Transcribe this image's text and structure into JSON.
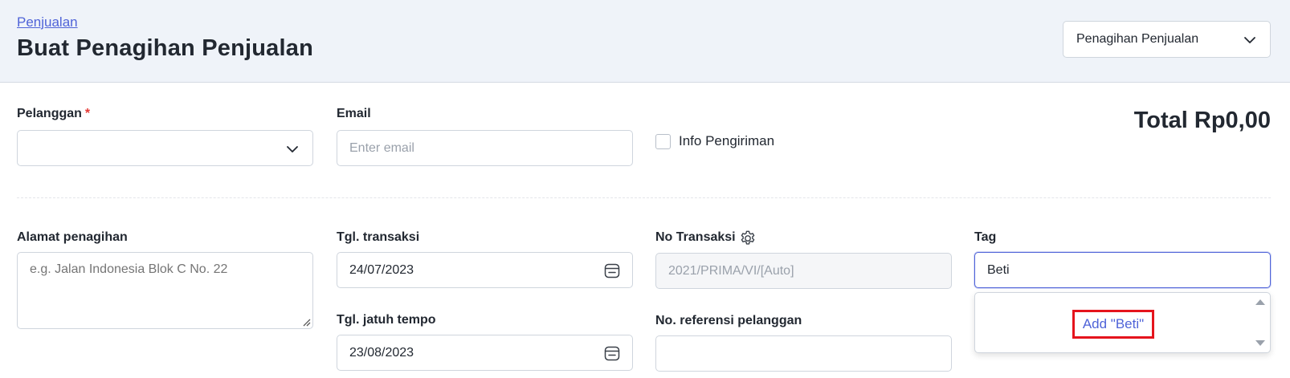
{
  "header": {
    "breadcrumb": "Penjualan",
    "title": "Buat Penagihan Penjualan",
    "type_select": {
      "value": "Penagihan Penjualan",
      "icon": "chevron-down-icon"
    }
  },
  "form": {
    "customer": {
      "label": "Pelanggan",
      "required_mark": "*",
      "value": "",
      "icon": "chevron-down-icon"
    },
    "email": {
      "label": "Email",
      "placeholder": "Enter email",
      "value": ""
    },
    "shipping_info": {
      "label": "Info Pengiriman",
      "checked": false
    },
    "total": {
      "text": "Total Rp0,00"
    },
    "billing_address": {
      "label": "Alamat penagihan",
      "placeholder": "e.g. Jalan Indonesia Blok C No. 22"
    },
    "transaction_date": {
      "label": "Tgl. transaksi",
      "value": "24/07/2023",
      "icon": "calendar-icon"
    },
    "due_date": {
      "label": "Tgl. jatuh tempo",
      "value": "23/08/2023",
      "icon": "calendar-icon"
    },
    "transaction_no": {
      "label": "No Transaksi",
      "placeholder": "2021/PRIMA/VI/[Auto]",
      "icon": "gear-icon"
    },
    "customer_ref": {
      "label": "No. referensi pelanggan",
      "value": ""
    },
    "tag": {
      "label": "Tag",
      "value": "Beti"
    },
    "tag_dropdown": {
      "add_option": "Add \"Beti\""
    }
  },
  "colors": {
    "accent": "#4f63d8",
    "highlight": "#e5141c",
    "header_bg": "#eff3f9",
    "required": "#e53935"
  }
}
